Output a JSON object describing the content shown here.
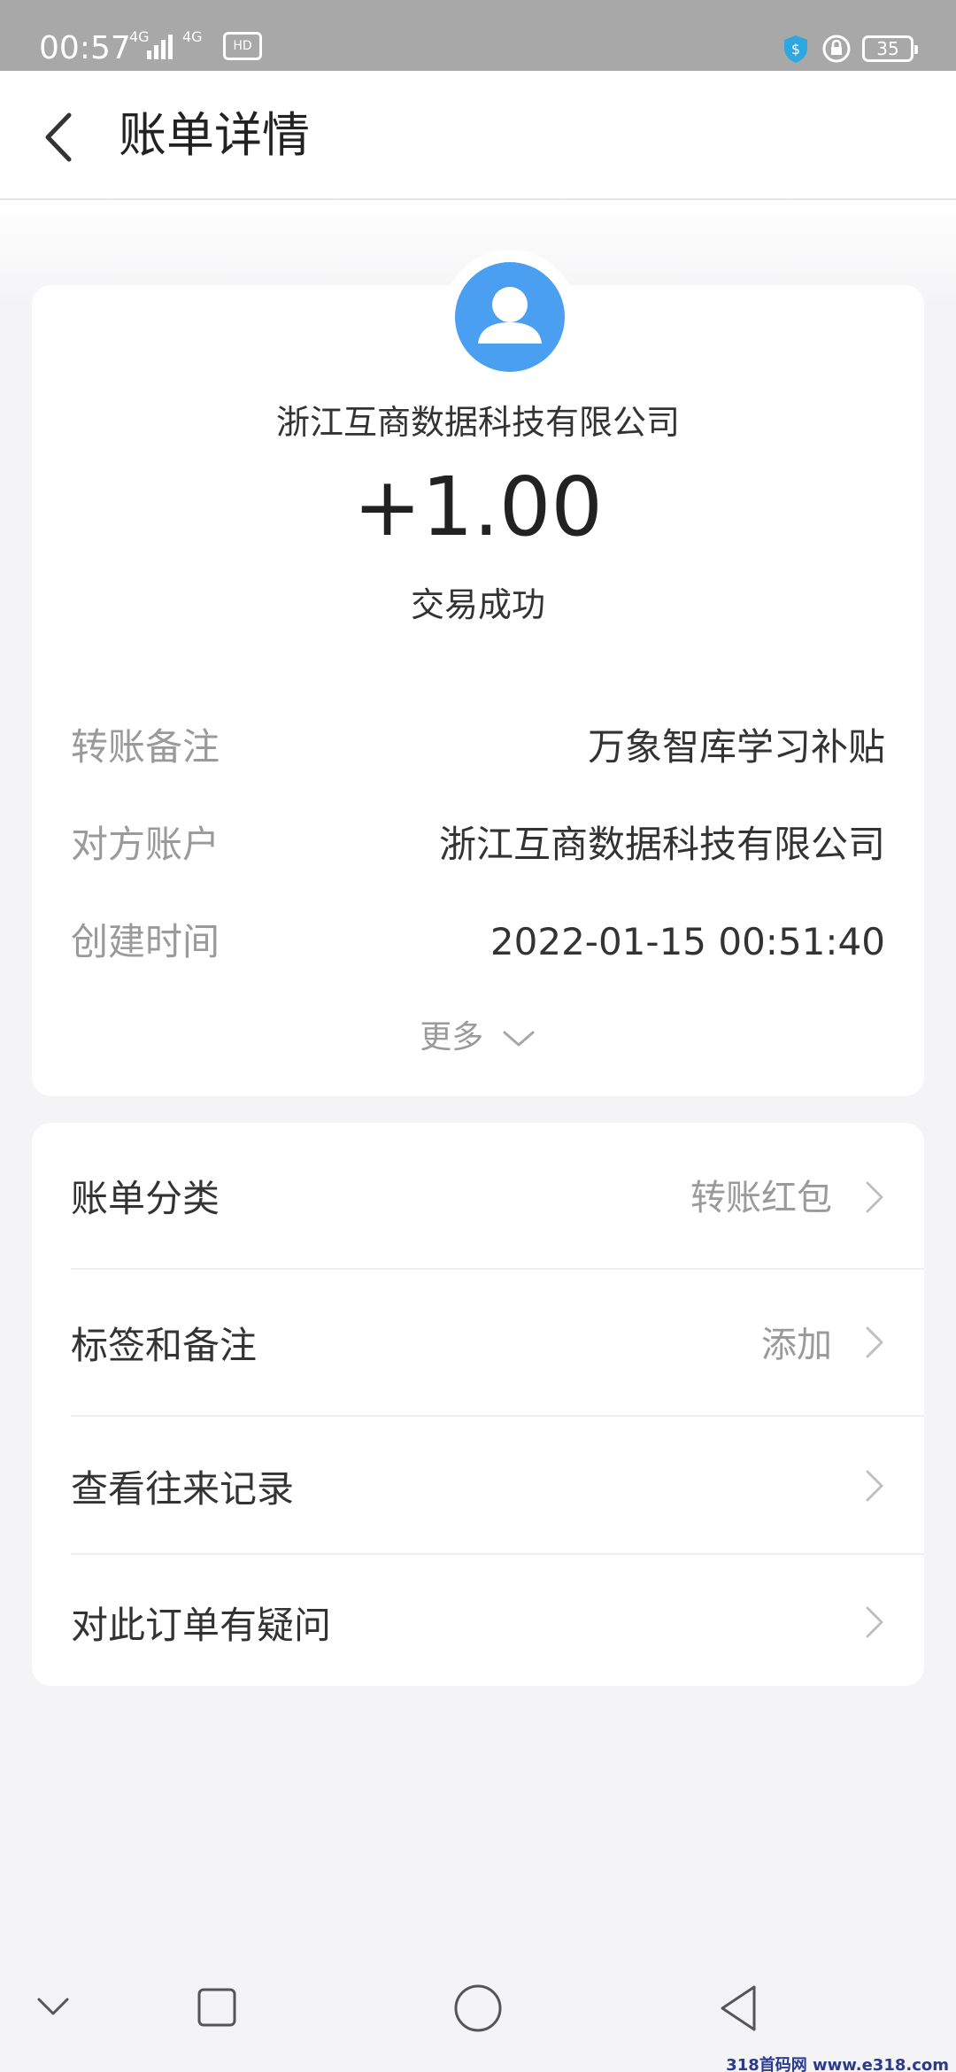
{
  "status_bar": {
    "time": "00:57",
    "signal1": "4G",
    "signal2": "4G",
    "hd": "HD",
    "battery": "35"
  },
  "header": {
    "title": "账单详情"
  },
  "transaction": {
    "payee": "浙江互商数据科技有限公司",
    "amount": "+1.00",
    "status": "交易成功",
    "details": [
      {
        "label": "转账备注",
        "value": "万象智库学习补贴"
      },
      {
        "label": "对方账户",
        "value": "浙江互商数据科技有限公司"
      },
      {
        "label": "创建时间",
        "value": "2022-01-15 00:51:40"
      }
    ],
    "more_label": "更多"
  },
  "menu": [
    {
      "label": "账单分类",
      "value": "转账红包"
    },
    {
      "label": "标签和备注",
      "value": "添加"
    },
    {
      "label": "查看往来记录",
      "value": ""
    },
    {
      "label": "对此订单有疑问",
      "value": ""
    }
  ],
  "watermark": "318首码网 www.e318.com",
  "colors": {
    "avatar": "#4a9ff0",
    "status_bar": "#a8a8a8",
    "muted_text": "#9a9a9a"
  }
}
